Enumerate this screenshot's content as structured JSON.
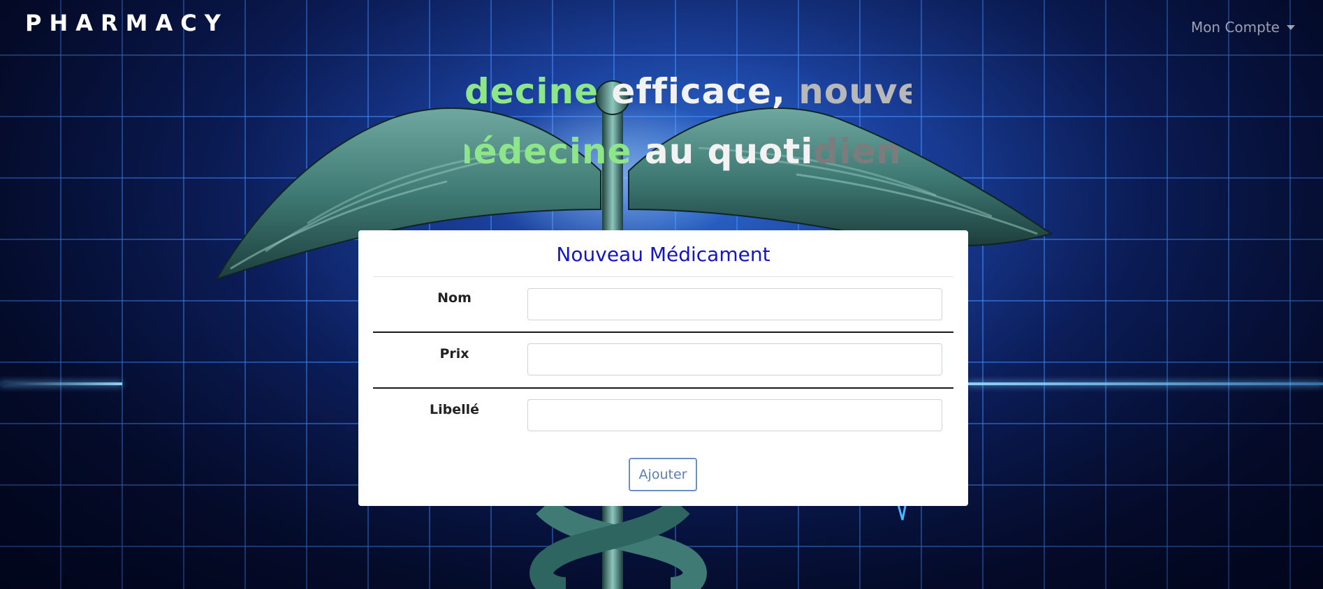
{
  "navbar": {
    "brand": "PHARMACY",
    "account_menu": "Mon Compte"
  },
  "slogan": {
    "line1": [
      {
        "text": "decine ",
        "tone": "green"
      },
      {
        "text": "efficace, ",
        "tone": "white"
      },
      {
        "text": "nouvelle",
        "tone": "grey"
      }
    ],
    "line2": [
      {
        "text": "nédecine ",
        "tone": "green"
      },
      {
        "text": "au ",
        "tone": "white"
      },
      {
        "text": "quoti",
        "tone": "white"
      },
      {
        "text": "dien !",
        "tone": "dgrey"
      }
    ]
  },
  "form": {
    "title": "Nouveau Médicament",
    "fields": [
      {
        "label": "Nom",
        "value": ""
      },
      {
        "label": "Prix",
        "value": ""
      },
      {
        "label": "Libellé",
        "value": ""
      }
    ],
    "submit_label": "Ajouter"
  },
  "colors": {
    "title": "#1414c8",
    "button_border": "#6b8fbf",
    "background": "#0c1f5e",
    "slogan_green": "#8ee68a"
  },
  "icons": {
    "background": "caduceus-icon",
    "dropdown": "caret-down-icon"
  }
}
